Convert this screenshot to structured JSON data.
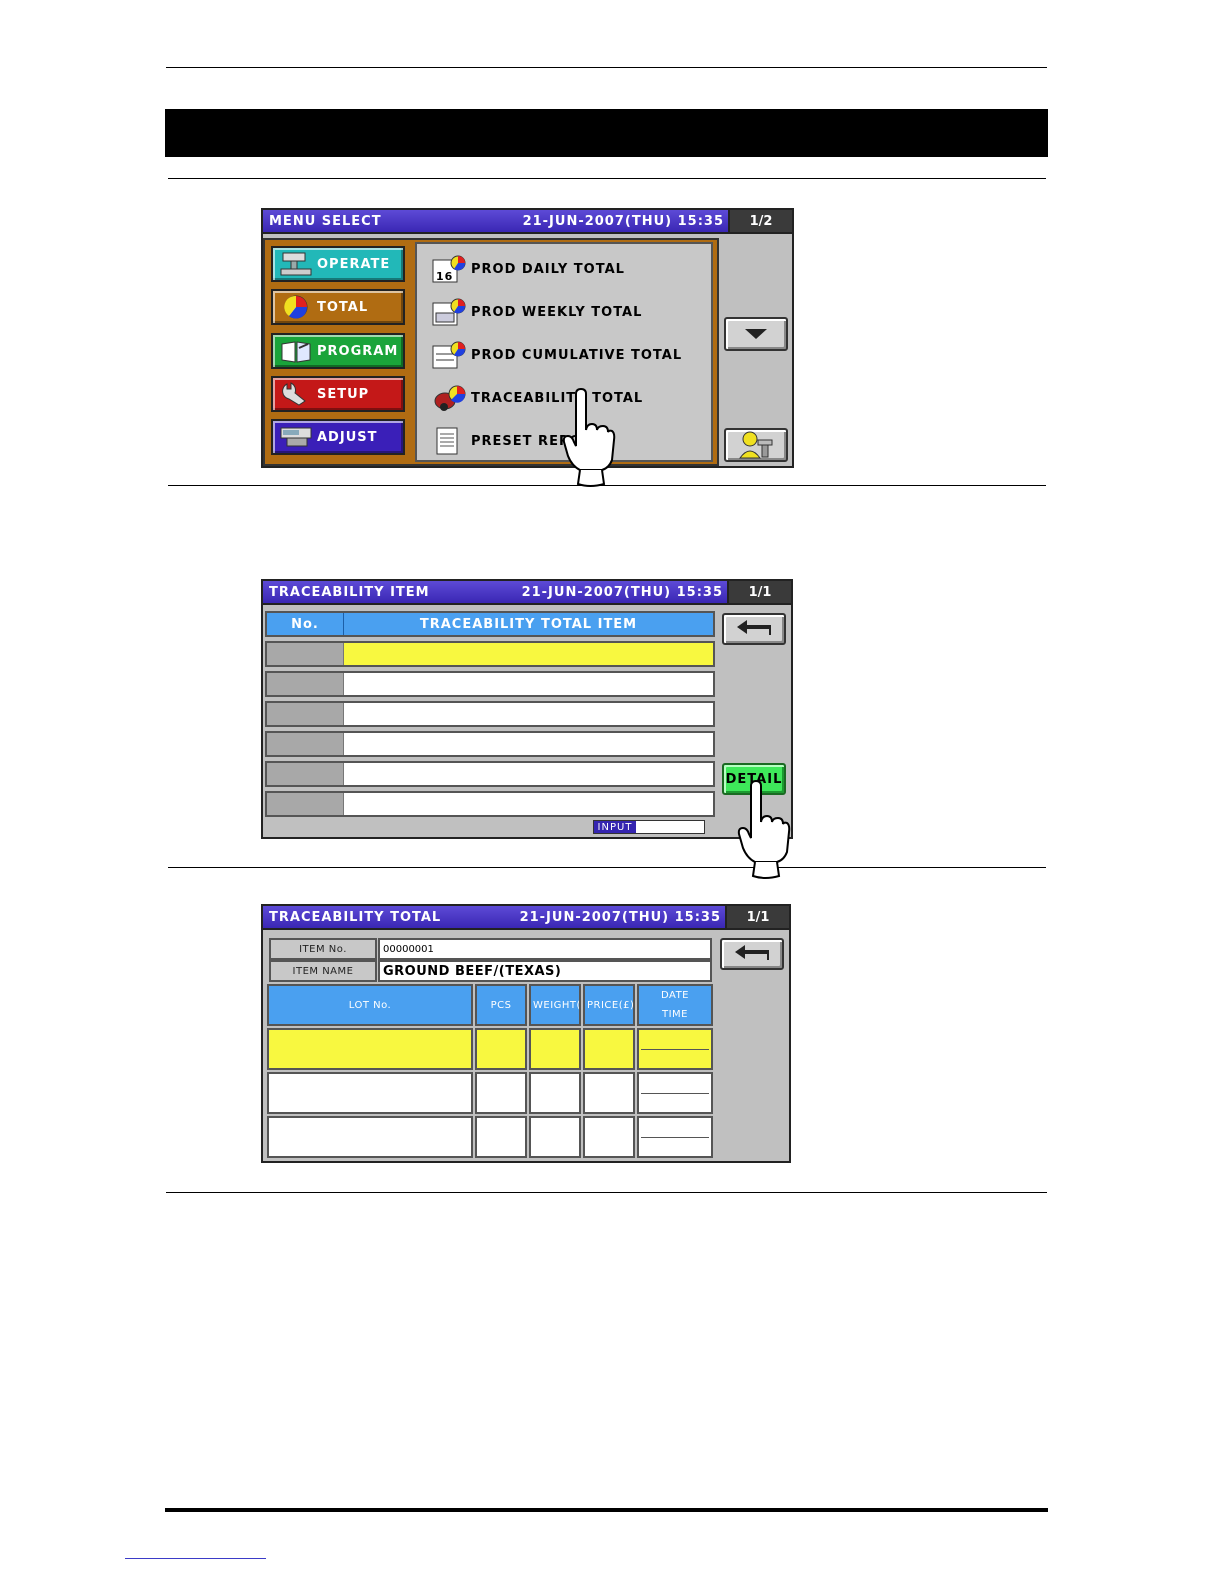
{
  "menu_screen": {
    "title": "MENU SELECT",
    "datetime": "21-JUN-2007(THU)  15:35",
    "page": "1/2",
    "categories": [
      {
        "label": "OPERATE",
        "color": "#22b8b8"
      },
      {
        "label": "TOTAL",
        "color": "#b06c12"
      },
      {
        "label": "PROGRAM",
        "color": "#1aa43a"
      },
      {
        "label": "SETUP",
        "color": "#c41818"
      },
      {
        "label": "ADJUST",
        "color": "#3a1fb8"
      }
    ],
    "items": [
      {
        "label": "PROD DAILY TOTAL"
      },
      {
        "label": "PROD WEEKLY TOTAL"
      },
      {
        "label": "PROD CUMULATIVE TOTAL"
      },
      {
        "label": "TRACEABILITY TOTAL"
      },
      {
        "label": "PRESET REPO"
      }
    ]
  },
  "item_screen": {
    "title": "TRACEABILITY ITEM",
    "datetime": "21-JUN-2007(THU)  15:35",
    "page": "1/1",
    "col_no": "No.",
    "col_item": "TRACEABILITY TOTAL ITEM",
    "detail_label": "DETAIL",
    "input_label": "INPUT"
  },
  "total_screen": {
    "title": "TRACEABILITY TOTAL",
    "datetime": "21-JUN-2007(THU)  15:35",
    "page": "1/1",
    "item_no_label": "ITEM No.",
    "item_no_value": "00000001",
    "item_name_label": "ITEM NAME",
    "item_name_value": "GROUND BEEF/(TEXAS)",
    "columns": {
      "lot": "LOT No.",
      "pcs": "PCS",
      "weight": "WEIGHT(",
      "price": "PRICE(£)",
      "date": "DATE",
      "time": "TIME"
    }
  }
}
